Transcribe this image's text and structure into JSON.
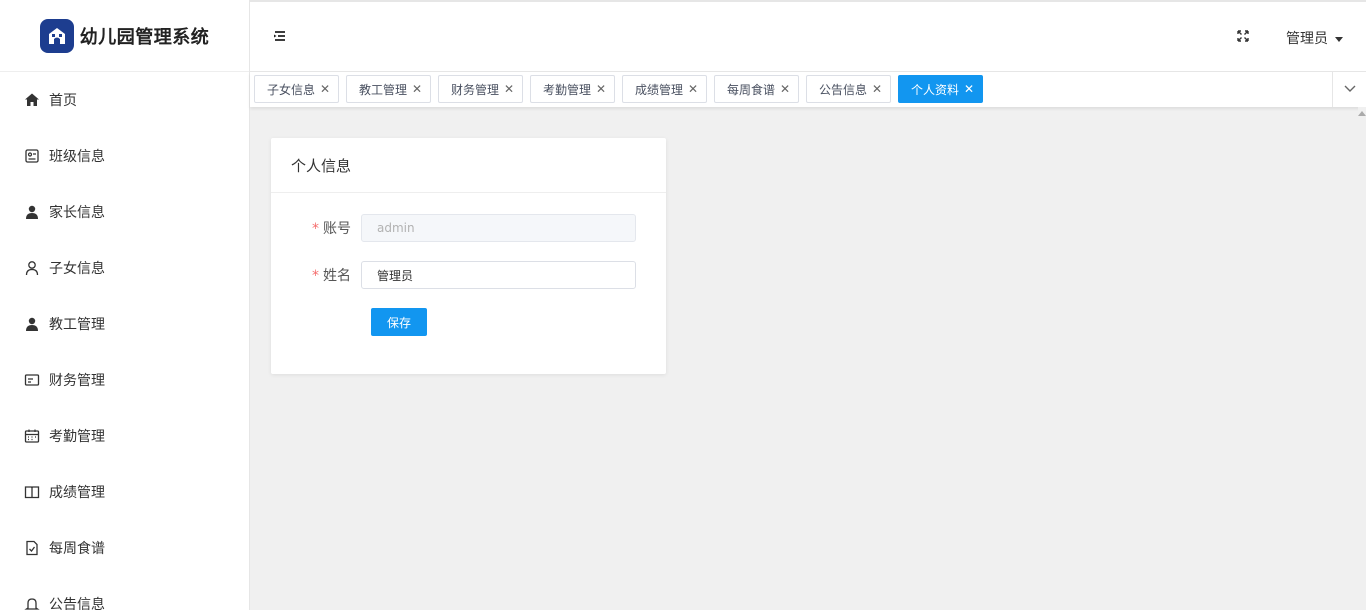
{
  "app": {
    "title": "幼儿园管理系统",
    "logo_icon": "kindergarten-logo-icon",
    "brand_color": "#1d3d8f"
  },
  "sidebar": {
    "items": [
      {
        "label": "首页",
        "icon": "home-icon"
      },
      {
        "label": "班级信息",
        "icon": "class-info-icon"
      },
      {
        "label": "家长信息",
        "icon": "user-filled-icon"
      },
      {
        "label": "子女信息",
        "icon": "user-outline-icon"
      },
      {
        "label": "教工管理",
        "icon": "user-filled-icon"
      },
      {
        "label": "财务管理",
        "icon": "finance-icon"
      },
      {
        "label": "考勤管理",
        "icon": "calendar-icon"
      },
      {
        "label": "成绩管理",
        "icon": "book-icon"
      },
      {
        "label": "每周食谱",
        "icon": "document-check-icon"
      },
      {
        "label": "公告信息",
        "icon": "bell-icon"
      }
    ]
  },
  "header": {
    "fold_icon": "menu-fold-icon",
    "fullscreen_icon": "fullscreen-icon",
    "user_name": "管理员"
  },
  "tags": {
    "items": [
      {
        "label": "子女信息",
        "active": false
      },
      {
        "label": "教工管理",
        "active": false
      },
      {
        "label": "财务管理",
        "active": false
      },
      {
        "label": "考勤管理",
        "active": false
      },
      {
        "label": "成绩管理",
        "active": false
      },
      {
        "label": "每周食谱",
        "active": false
      },
      {
        "label": "公告信息",
        "active": false
      },
      {
        "label": "个人资料",
        "active": true
      }
    ],
    "close_glyph": "✕",
    "accent_color": "#1296f0"
  },
  "profile": {
    "card_title": "个人信息",
    "required_mark": "*",
    "account_label": "账号",
    "account_value": "admin",
    "name_label": "姓名",
    "name_value": "管理员",
    "save_label": "保存"
  }
}
